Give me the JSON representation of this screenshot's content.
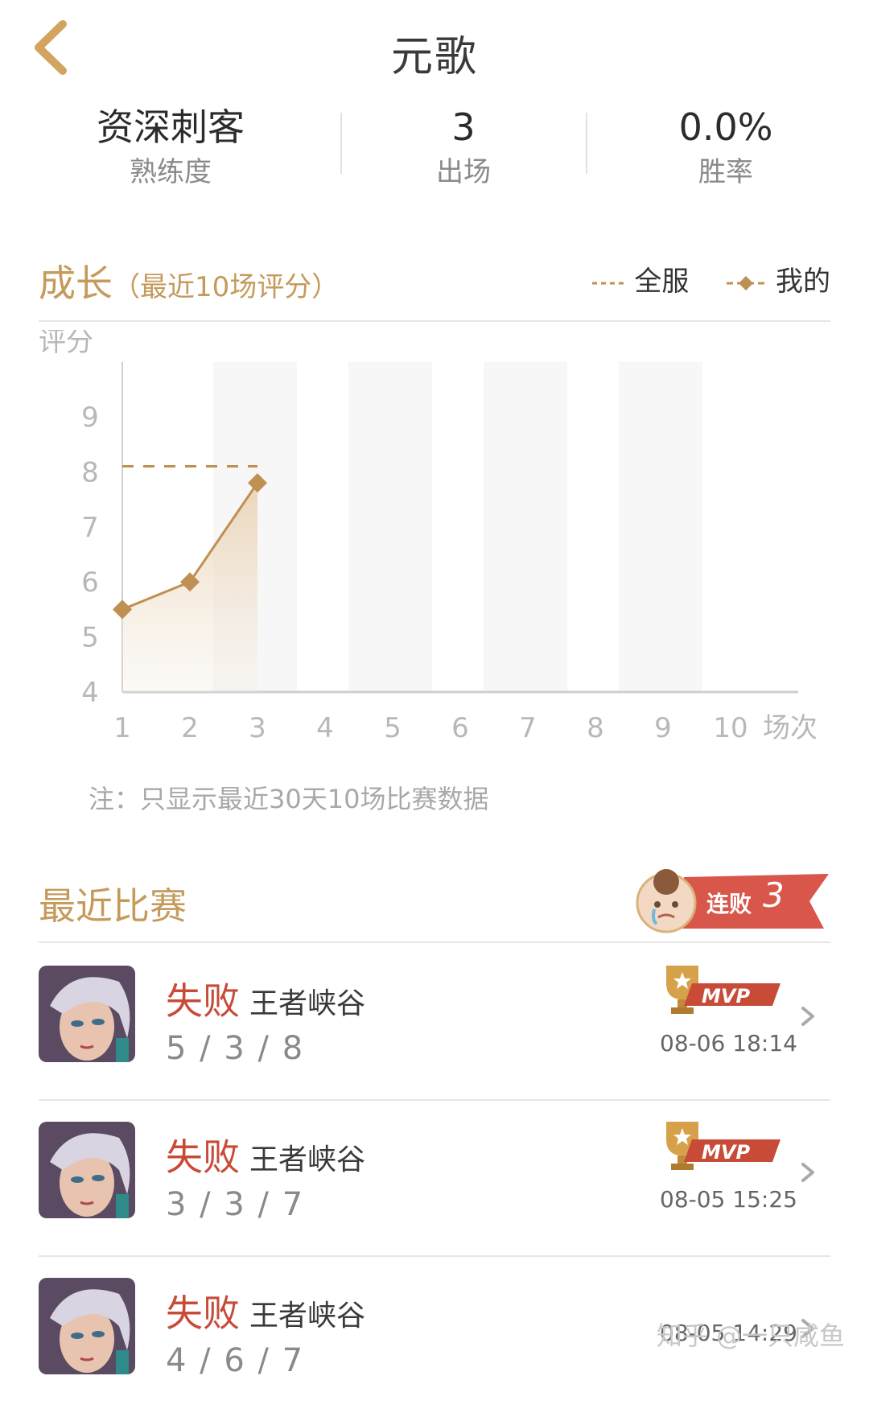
{
  "header": {
    "title": "元歌",
    "back_icon": "chevron-left-icon"
  },
  "stats": [
    {
      "value": "资深刺客",
      "label": "熟练度"
    },
    {
      "value": "3",
      "label": "出场"
    },
    {
      "value": "0.0%",
      "label": "胜率"
    }
  ],
  "growth": {
    "title": "成长",
    "subtitle": "（最近10场评分）",
    "legend_all": "全服",
    "legend_mine": "我的",
    "note": "注：只显示最近30天10场比赛数据"
  },
  "chart_data": {
    "type": "line",
    "ylabel": "评分",
    "xlabel": "场次",
    "x": [
      1,
      2,
      3,
      4,
      5,
      6,
      7,
      8,
      9,
      10
    ],
    "yticks": [
      4,
      5,
      6,
      7,
      8,
      9
    ],
    "ylim": [
      4,
      10
    ],
    "xlim": [
      1,
      10
    ],
    "series": [
      {
        "name": "我的",
        "x": [
          1,
          2,
          3
        ],
        "values": [
          5.5,
          6.0,
          7.8
        ],
        "style": "solid-diamond"
      },
      {
        "name": "全服",
        "x": [
          1,
          3
        ],
        "values": [
          8.1,
          8.1
        ],
        "style": "dashed"
      }
    ],
    "colors": {
      "line": "#c08f52",
      "accent": "#c59a5b",
      "band": "#f7f7f7"
    },
    "grid": false
  },
  "recent": {
    "title": "最近比赛",
    "streak_label": "连败",
    "streak_count": "3",
    "matches": [
      {
        "result": "失败",
        "mode": "王者峡谷",
        "kda": "5 / 3 / 8",
        "mvp": true,
        "mvp_label": "MVP",
        "time": "08-06 18:14"
      },
      {
        "result": "失败",
        "mode": "王者峡谷",
        "kda": "3 / 3 / 7",
        "mvp": true,
        "mvp_label": "MVP",
        "time": "08-05 15:25"
      },
      {
        "result": "失败",
        "mode": "王者峡谷",
        "kda": "4 / 6 / 7",
        "mvp": false,
        "mvp_label": "",
        "time": "08-05 14:29"
      }
    ]
  },
  "watermark": "知乎 @一只咸鱼"
}
